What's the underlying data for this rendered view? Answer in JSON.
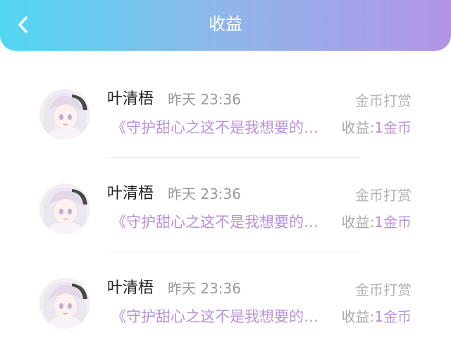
{
  "header": {
    "back_icon": "chevron-left-icon",
    "title": "收益"
  },
  "colors": {
    "header_gradient": [
      "#52d6f2",
      "#b394e6"
    ],
    "accent_purple": "#b790dc"
  },
  "items": [
    {
      "name": "叶清梧",
      "time": "昨天 23:36",
      "type": "金币打赏",
      "description": "《守护甜心之这不是我想要的…",
      "income_label": "收益:",
      "income_value": "1金币"
    },
    {
      "name": "叶清梧",
      "time": "昨天 23:36",
      "type": "金币打赏",
      "description": "《守护甜心之这不是我想要的…",
      "income_label": "收益:",
      "income_value": "1金币"
    },
    {
      "name": "叶清梧",
      "time": "昨天 23:36",
      "type": "金币打赏",
      "description": "《守护甜心之这不是我想要的…",
      "income_label": "收益:",
      "income_value": "1金币"
    }
  ]
}
